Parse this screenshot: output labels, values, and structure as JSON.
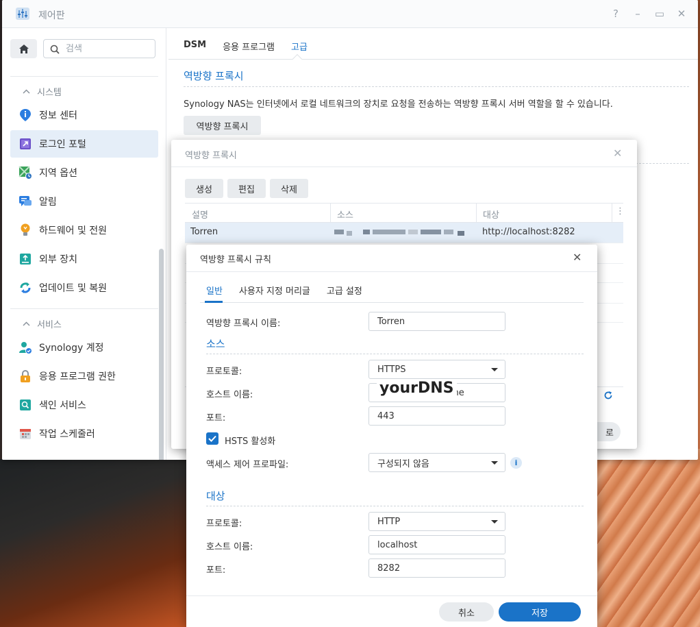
{
  "window": {
    "title": "제어판",
    "controls": [
      "?",
      "–",
      "▭",
      "✕"
    ]
  },
  "sidebar": {
    "search_placeholder": "검색",
    "sections": [
      {
        "title": "시스템",
        "items": [
          {
            "label": "정보 센터",
            "icon": "info-icon"
          },
          {
            "label": "로그인 포털",
            "icon": "login-portal-icon",
            "active": true
          },
          {
            "label": "지역 옵션",
            "icon": "regional-options-icon"
          },
          {
            "label": "알림",
            "icon": "notification-icon"
          },
          {
            "label": "하드웨어 및 전원",
            "icon": "hardware-power-icon"
          },
          {
            "label": "외부 장치",
            "icon": "external-device-icon"
          },
          {
            "label": "업데이트 및 복원",
            "icon": "update-restore-icon"
          }
        ]
      },
      {
        "title": "서비스",
        "items": [
          {
            "label": "Synology 계정",
            "icon": "synology-account-icon"
          },
          {
            "label": "응용 프로그램 권한",
            "icon": "app-privileges-icon"
          },
          {
            "label": "색인 서비스",
            "icon": "indexing-service-icon"
          },
          {
            "label": "작업 스케줄러",
            "icon": "task-scheduler-icon"
          }
        ]
      }
    ]
  },
  "content": {
    "tabs": [
      "DSM",
      "응용 프로그램",
      "고급"
    ],
    "selected_tab": "고급",
    "section_title": "역방향 프록시",
    "section_desc": "Synology NAS는 인터넷에서 로컬 네트워크의 장치로 요청을 전송하는 역방향 프록시 서버 역할을 할 수 있습니다.",
    "section_button": "역방향 프록시"
  },
  "proxy_list_dialog": {
    "title": "역방향 프록시",
    "buttons": [
      "생성",
      "편집",
      "삭제"
    ],
    "columns": [
      "설명",
      "소스",
      "대상"
    ],
    "rows": [
      {
        "description": "Torren",
        "source": "(pixelated)",
        "destination": "http://localhost:8282"
      }
    ],
    "footer_button_partial": "로"
  },
  "proxy_rule_dialog": {
    "title": "역방향 프록시 규칙",
    "tabs": [
      "일반",
      "사용자 지정 머리글",
      "고급 설정"
    ],
    "selected_tab": "일반",
    "name_label": "역방향 프록시 이름:",
    "name_value": "Torren",
    "source": {
      "title": "소스",
      "protocol_label": "프로토콜:",
      "protocol_value": "HTTPS",
      "host_label": "호스트 이름:",
      "host_value": ".me",
      "host_overlay": "yourDNS",
      "port_label": "포트:",
      "port_value": "443",
      "hsts_label": "HSTS 활성화",
      "hsts_checked": true,
      "access_label": "액세스 제어 프로파일:",
      "access_value": "구성되지 않음"
    },
    "destination": {
      "title": "대상",
      "protocol_label": "프로토콜:",
      "protocol_value": "HTTP",
      "host_label": "호스트 이름:",
      "host_value": "localhost",
      "port_label": "포트:",
      "port_value": "8282"
    },
    "cancel_label": "취소",
    "save_label": "저장"
  },
  "colors": {
    "accent": "#1a73c8",
    "selection": "#e5eef8",
    "button_gray": "#e8ebee"
  }
}
